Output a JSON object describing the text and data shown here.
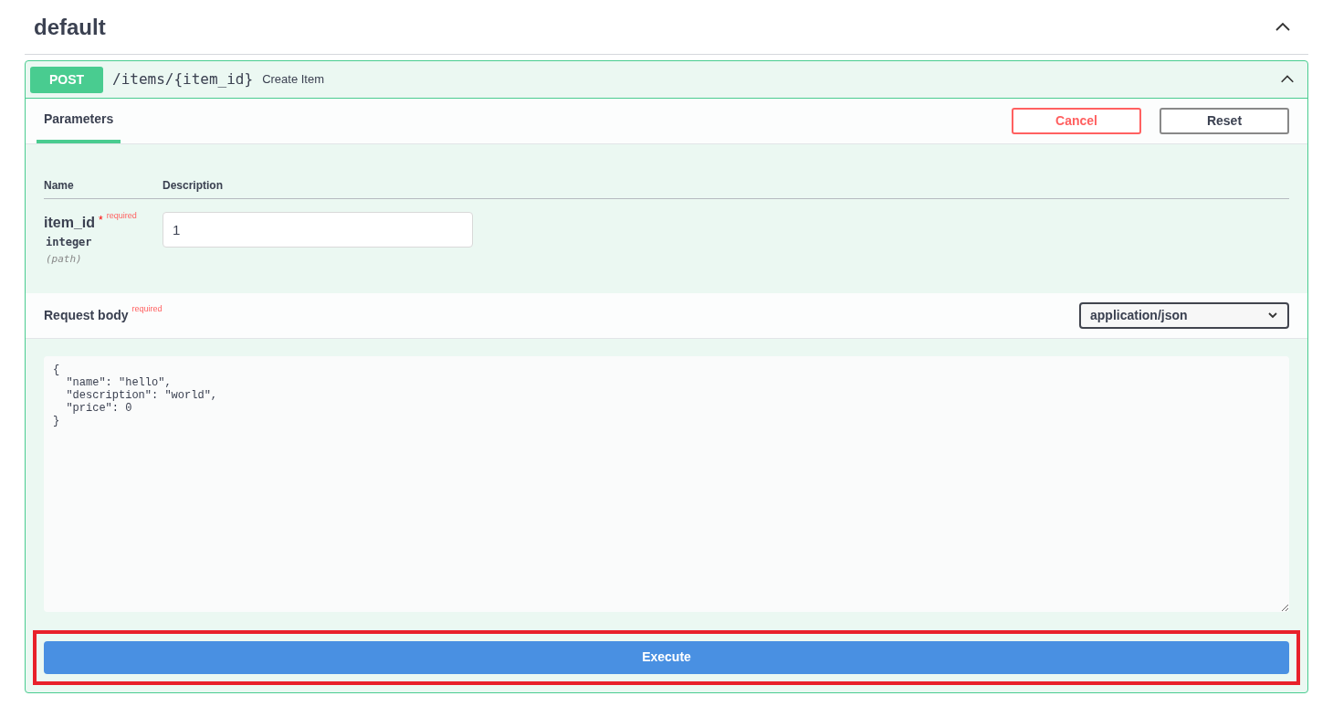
{
  "section": {
    "title": "default",
    "expanded": true
  },
  "operation": {
    "method": "POST",
    "path": "/items/{item_id}",
    "summary": "Create Item",
    "expanded": true,
    "tabs": [
      {
        "label": "Parameters",
        "selected": true
      }
    ],
    "buttons": [
      {
        "label": "Cancel",
        "kind": "cancel"
      },
      {
        "label": "Reset",
        "kind": "reset"
      }
    ],
    "parameters": {
      "columns": [
        "Name",
        "Description"
      ],
      "rows": [
        {
          "name": "item_id",
          "required_mark": "*",
          "required_label": "required",
          "type": "integer",
          "location": "(path)",
          "value": "1"
        }
      ]
    },
    "request_body": {
      "title": "Request body",
      "required_label": "required",
      "content_type": "application/json",
      "value": "{\n  \"name\": \"hello\",\n  \"description\": \"world\",\n  \"price\": 0\n}"
    },
    "execute": {
      "label": "Execute",
      "highlighted": true
    }
  }
}
